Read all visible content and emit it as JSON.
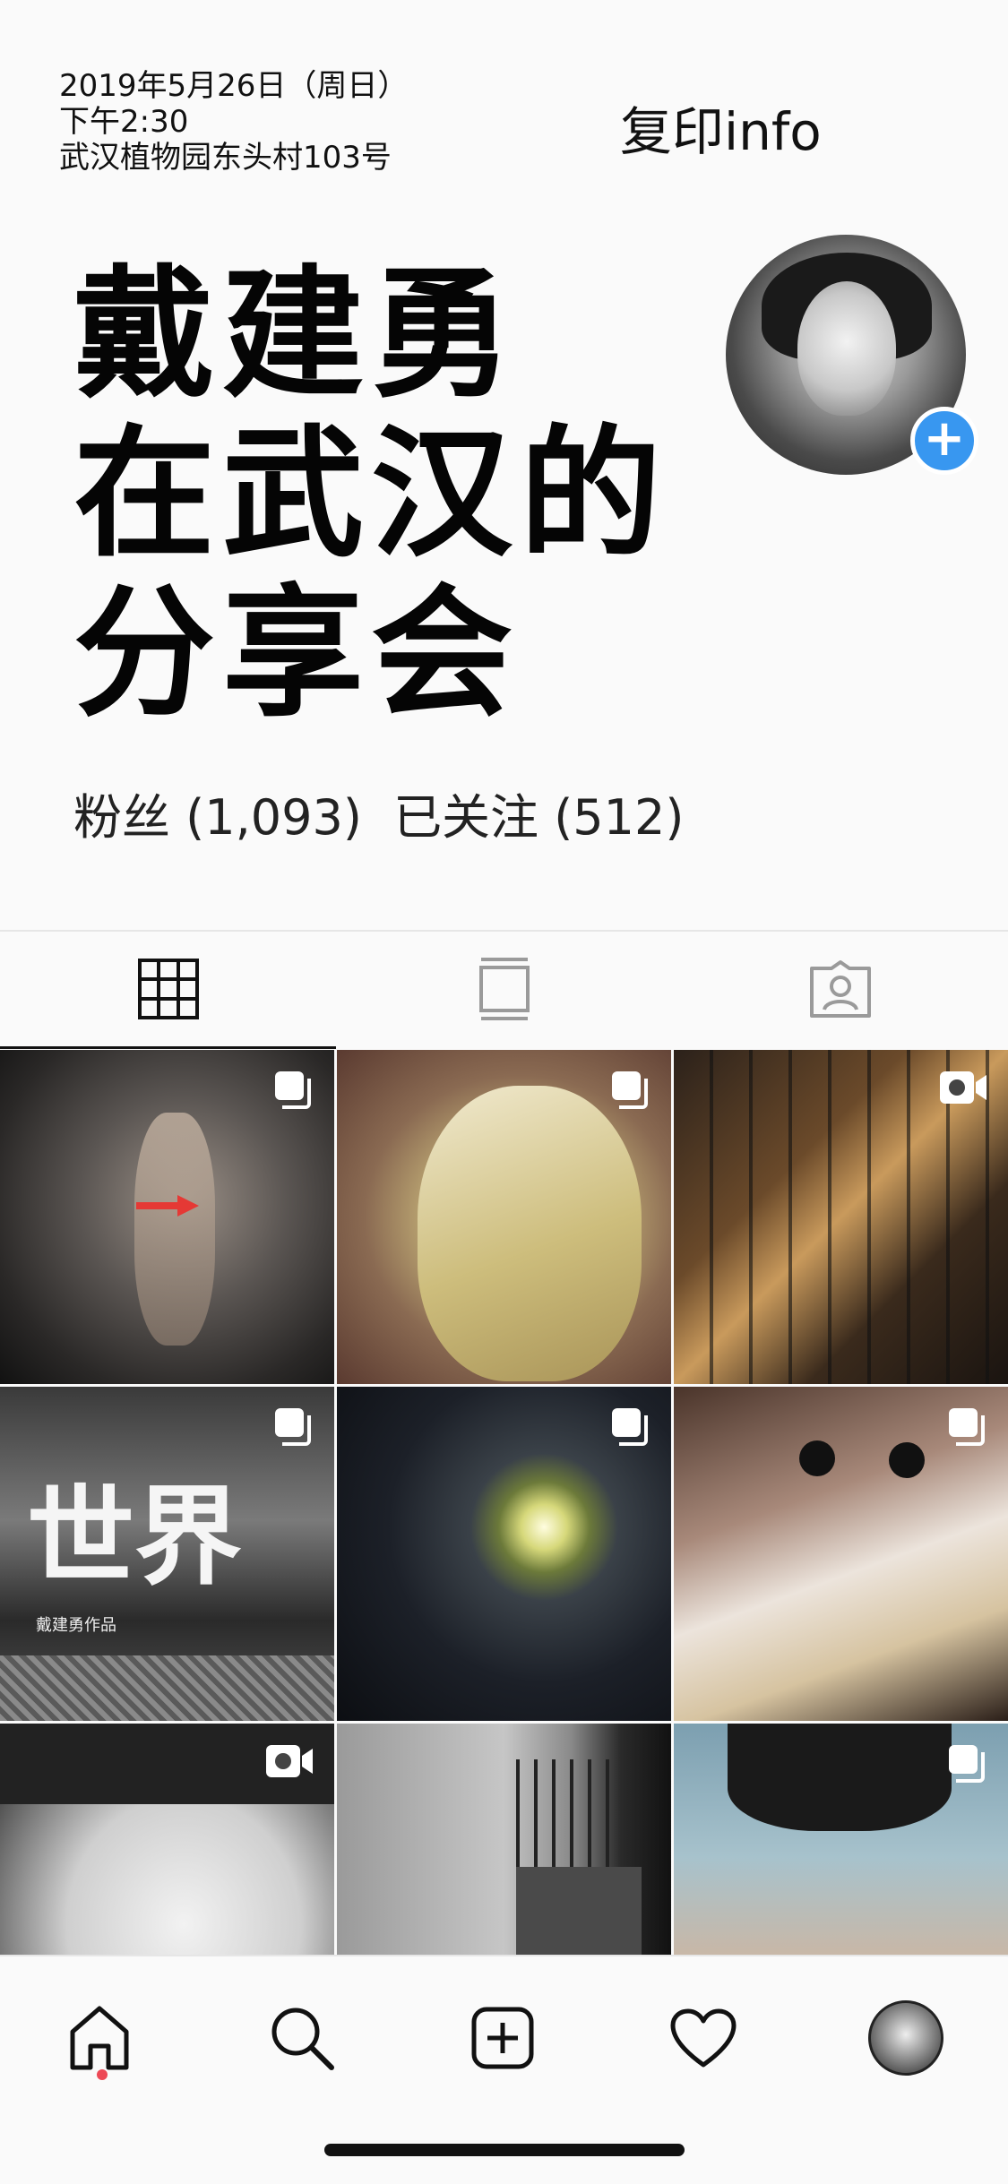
{
  "meta": {
    "date": "2019年5月26日（周日）",
    "time": "下午2:30",
    "location": "武汉植物园东头村103号"
  },
  "header": {
    "copy_info": "复印info"
  },
  "title": {
    "line1": "戴建勇",
    "line2": "在武汉的",
    "line3": "分享会"
  },
  "stats": {
    "followers": "粉丝 (1,093)",
    "following": "已关注 (512)"
  },
  "tabs": [
    {
      "icon": "grid-icon",
      "active": true
    },
    {
      "icon": "feed-icon",
      "active": false
    },
    {
      "icon": "tagged-icon",
      "active": false
    }
  ],
  "posts": [
    {
      "badge": "multi-photo-icon"
    },
    {
      "badge": "multi-photo-icon"
    },
    {
      "badge": "video-icon"
    },
    {
      "badge": "multi-photo-icon",
      "text": "世界",
      "caption": "戴建勇作品"
    },
    {
      "badge": "multi-photo-icon"
    },
    {
      "badge": "multi-photo-icon"
    },
    {
      "badge": "video-icon"
    },
    {
      "badge": ""
    },
    {
      "badge": "multi-photo-icon"
    }
  ],
  "nav": [
    "home-icon",
    "search-icon",
    "new-post-icon",
    "activity-icon",
    "profile-avatar"
  ],
  "colors": {
    "accent": "#3897f0",
    "notification": "#ed4956"
  }
}
